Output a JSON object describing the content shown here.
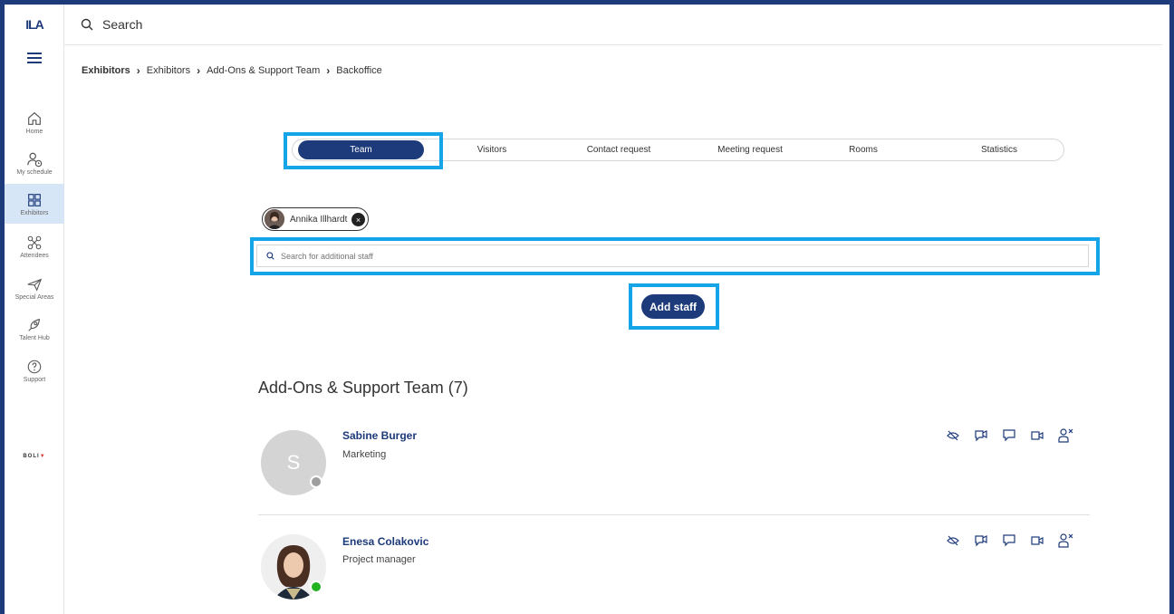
{
  "app": {
    "logo": "ILA",
    "brand": "BOLI",
    "brand_mark": "▼"
  },
  "topbar": {
    "search_placeholder": "Search"
  },
  "sidebar": {
    "items": [
      {
        "label": "Home",
        "icon": "home-icon"
      },
      {
        "label": "My schedule",
        "icon": "schedule-icon"
      },
      {
        "label": "Exhibitors",
        "icon": "exhibitors-icon",
        "active": true
      },
      {
        "label": "Attendees",
        "icon": "attendees-icon"
      },
      {
        "label": "Special Areas",
        "icon": "plane-icon"
      },
      {
        "label": "Talent Hub",
        "icon": "rocket-icon"
      },
      {
        "label": "Support",
        "icon": "help-icon"
      }
    ]
  },
  "breadcrumb": [
    "Exhibitors",
    "Exhibitors",
    "Add-Ons & Support Team",
    "Backoffice"
  ],
  "tabs": [
    "Team",
    "Visitors",
    "Contact request",
    "Meeting request",
    "Rooms",
    "Statistics"
  ],
  "chip": {
    "name": "Annika Illhardt",
    "remove": "×"
  },
  "staff_search": {
    "placeholder": "Search for additional staff"
  },
  "add_staff": "Add staff",
  "section": {
    "title": "Add-Ons & Support Team (7)"
  },
  "people": [
    {
      "name": "Sabine Burger",
      "role": "Marketing",
      "initial": "S",
      "status_color": "#9e9e9e"
    },
    {
      "name": "Enesa Colakovic",
      "role": "Project manager",
      "initial": "",
      "status_color": "#22b322"
    }
  ],
  "colors": {
    "primary": "#1d3a7a",
    "highlight": "#14a5e9",
    "active_nav": "#d6e6f7"
  }
}
